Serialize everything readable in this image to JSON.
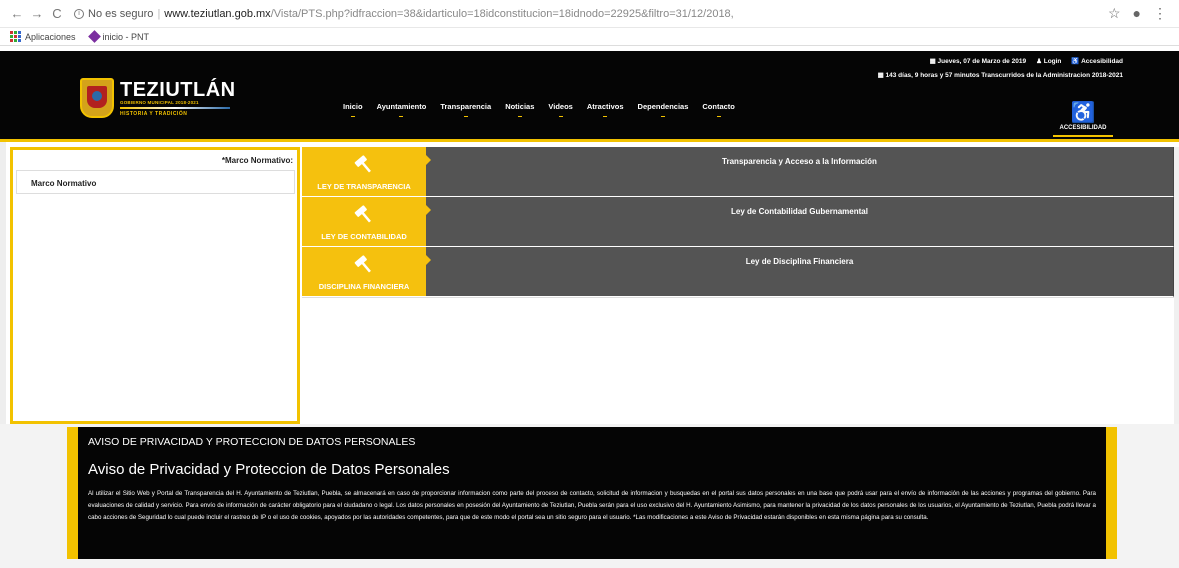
{
  "browser": {
    "insecure_label": "No es seguro",
    "url_host": "www.teziutlan.gob.mx",
    "url_path": "/Vista/PTS.php?idfraccion=38&idarticulo=18idconstitucion=18idnodo=22925&filtro=31/12/2018,",
    "bookmarks": [
      "Aplicaciones",
      "inicio - PNT"
    ]
  },
  "header": {
    "logo_title": "TEZIUTLÁN",
    "logo_sub": "GOBIERNO MUNICIPAL 2018-2021",
    "logo_motto": "HISTORIA Y TRADICIÓN",
    "date": "Jueves, 07 de Marzo de 2019",
    "login": "Login",
    "accessibility_link": "Accesibilidad",
    "elapsed": "143 días, 9 horas y 57 minutos Transcurridos de la Administracion 2018-2021",
    "accessibility_label": "ACCESIBILIDAD",
    "nav": [
      "Inicio",
      "Ayuntamiento",
      "Transparencia",
      "Noticias",
      "Videos",
      "Atractivos",
      "Dependencias",
      "Contacto"
    ]
  },
  "sidebar": {
    "heading": "*Marco Normativo:",
    "items": [
      "Marco Normativo"
    ]
  },
  "laws": [
    {
      "badge": "LEY DE TRANSPARENCIA",
      "title": "Transparencia y Acceso a la Información",
      "icon": "gavel-icon"
    },
    {
      "badge": "LEY DE CONTABILIDAD",
      "title": "Ley de Contabilidad Gubernamental",
      "icon": "gavel-icon"
    },
    {
      "badge": "DISCIPLINA FINANCIERA",
      "title": "Ley de Disciplina Financiera",
      "icon": "gavel-icon"
    }
  ],
  "privacy": {
    "heading": "AVISO DE PRIVACIDAD Y PROTECCION DE DATOS PERSONALES",
    "title": "Aviso de Privacidad y Proteccion de Datos Personales",
    "text": "Al utilizar el Sitio Web y Portal de Transparencia del H. Ayuntamiento de Teziutlan, Puebla, se almacenará en caso de proporcionar informacion como parte del proceso de contacto, solicitud de informacion y busquedas en el portal sus datos personales en una base que podrá usar para el envío de información de las acciones y programas del gobierno. Para evaluaciones de calidad y servicio. Para envío de información de carácter obligatorio para el ciudadano o legal. Los datos personales en posesión del Ayuntamiento de Teziutlan, Puebla serán para el uso exclusivo del H. Ayuntamiento Asimismo, para mantener la privacidad de los datos personales de los usuarios, el Ayuntamiento de Teziutlan, Puebla podrá llevar a cabo acciones de Seguridad lo cual puede incluir el rastreo de IP o el uso de cookies, apoyados por las autoridades competentes, para que de este modo el portal sea un sitio seguro para el usuario. *Las modificaciones a este Aviso de Privacidad estarán disponibles en esta misma página para su consulta."
  },
  "colors": {
    "accent": "#f2c200",
    "header_bg": "#050505",
    "law_row": "#545454"
  }
}
